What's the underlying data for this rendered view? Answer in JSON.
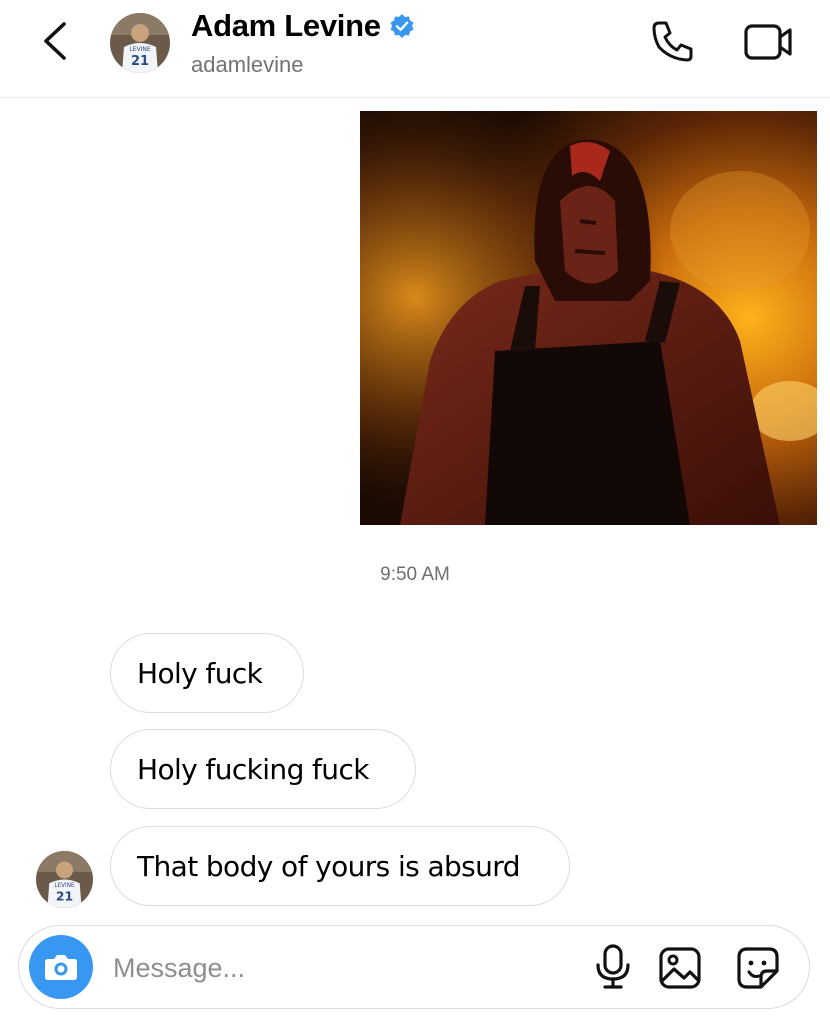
{
  "header": {
    "display_name": "Adam Levine",
    "username": "adamlevine",
    "verified": true,
    "icons": {
      "back": "chevron-left-icon",
      "verified": "verified-badge-icon",
      "call": "phone-icon",
      "video": "video-camera-icon"
    }
  },
  "thread": {
    "photo_alt": "",
    "timestamp": "9:50 AM",
    "messages": [
      {
        "text": "Holy fuck"
      },
      {
        "text": "Holy fucking fuck"
      },
      {
        "text": "That body of yours is absurd"
      }
    ]
  },
  "composer": {
    "placeholder": "Message...",
    "value": "",
    "icons": {
      "camera": "camera-icon",
      "mic": "microphone-icon",
      "gallery": "image-gallery-icon",
      "sticker": "sticker-icon"
    }
  },
  "colors": {
    "accent": "#3897f0",
    "verified": "#3897f0",
    "bubble_border": "#dcdcdc",
    "muted_text": "#737373"
  }
}
